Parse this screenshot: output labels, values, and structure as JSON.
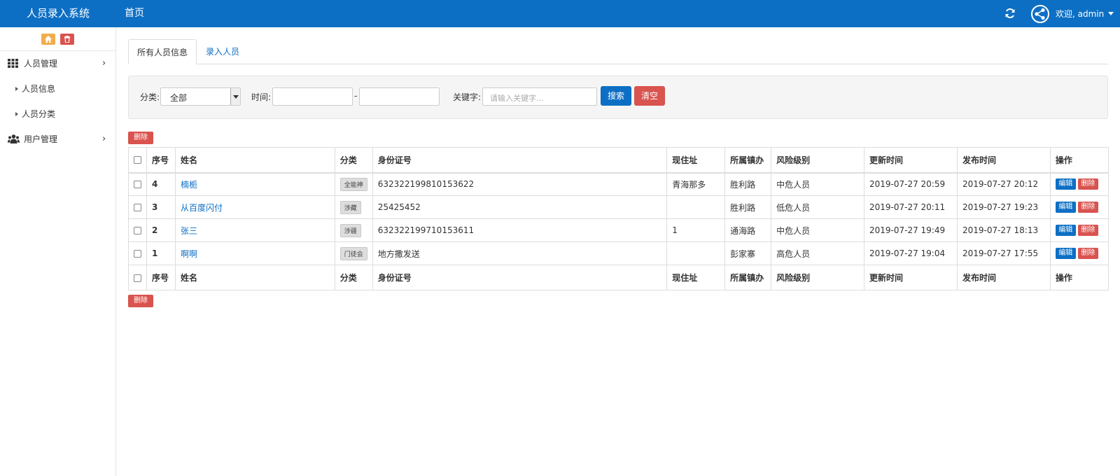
{
  "topbar": {
    "brand": "人员录入系统",
    "home": "首页",
    "welcome": "欢迎, admin",
    "icons": [
      "refresh-icon",
      "share-icon",
      "caret-down-icon"
    ]
  },
  "sidebar": {
    "groups": [
      {
        "label": "人员管理",
        "icon": "grid-icon",
        "items": [
          "人员信息",
          "人员分类"
        ]
      },
      {
        "label": "用户管理",
        "icon": "users-icon",
        "items": []
      }
    ],
    "colors": {
      "orange": "#f0ad4e",
      "red": "#d9534f"
    }
  },
  "tabs": [
    "所有人员信息",
    "录入人员"
  ],
  "filter": {
    "category_label": "分类:",
    "category_value": "全部",
    "time_label": "时间:",
    "time_sep": "-",
    "keyword_label": "关键字:",
    "keyword_placeholder": "请输入关键字...",
    "search_button": "搜索",
    "clear_button": "清空"
  },
  "delete_button": "删除",
  "table": {
    "headers": [
      "序号",
      "姓名",
      "分类",
      "身份证号",
      "现住址",
      "所属镇办",
      "风险级别",
      "更新时间",
      "发布时间",
      "操作"
    ],
    "rows": [
      {
        "id": "4",
        "name": "楠栀",
        "category": "全能神",
        "idcard": "632322199810153622",
        "address": "青海那多",
        "town": "胜利路",
        "risk": "中危人员",
        "updated": "2019-07-27 20:59",
        "published": "2019-07-27 20:12"
      },
      {
        "id": "3",
        "name": "从百度闪付",
        "category": "涉藏",
        "idcard": "25425452",
        "address": "",
        "town": "胜利路",
        "risk": "低危人员",
        "updated": "2019-07-27 20:11",
        "published": "2019-07-27 19:23"
      },
      {
        "id": "2",
        "name": "张三",
        "category": "涉疆",
        "idcard": "632322199710153611",
        "address": "1",
        "town": "通海路",
        "risk": "中危人员",
        "updated": "2019-07-27 19:49",
        "published": "2019-07-27 18:13"
      },
      {
        "id": "1",
        "name": "啊啊",
        "category": "门徒会",
        "idcard": "地方撒发送",
        "address": "",
        "town": "彭家寨",
        "risk": "高危人员",
        "updated": "2019-07-27 19:04",
        "published": "2019-07-27 17:55"
      }
    ],
    "edit_label": "编辑",
    "delete_label": "删除"
  },
  "colors": {
    "primary": "#0d6fc4",
    "danger": "#d9534f",
    "warning": "#f0ad4e"
  }
}
